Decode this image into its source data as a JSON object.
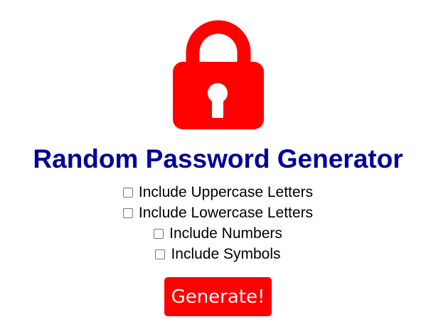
{
  "icon": {
    "name": "lock-icon",
    "color": "#ff0000"
  },
  "title": {
    "text": "Random Password Generator",
    "color": "#000099"
  },
  "options": [
    {
      "label": "Include Uppercase Letters",
      "checked": false
    },
    {
      "label": "Include Lowercase Letters",
      "checked": false
    },
    {
      "label": "Include Numbers",
      "checked": false
    },
    {
      "label": "Include Symbols",
      "checked": false
    }
  ],
  "button": {
    "label": "Generate!",
    "color": "#ff0000",
    "text_color": "#ffffff"
  }
}
